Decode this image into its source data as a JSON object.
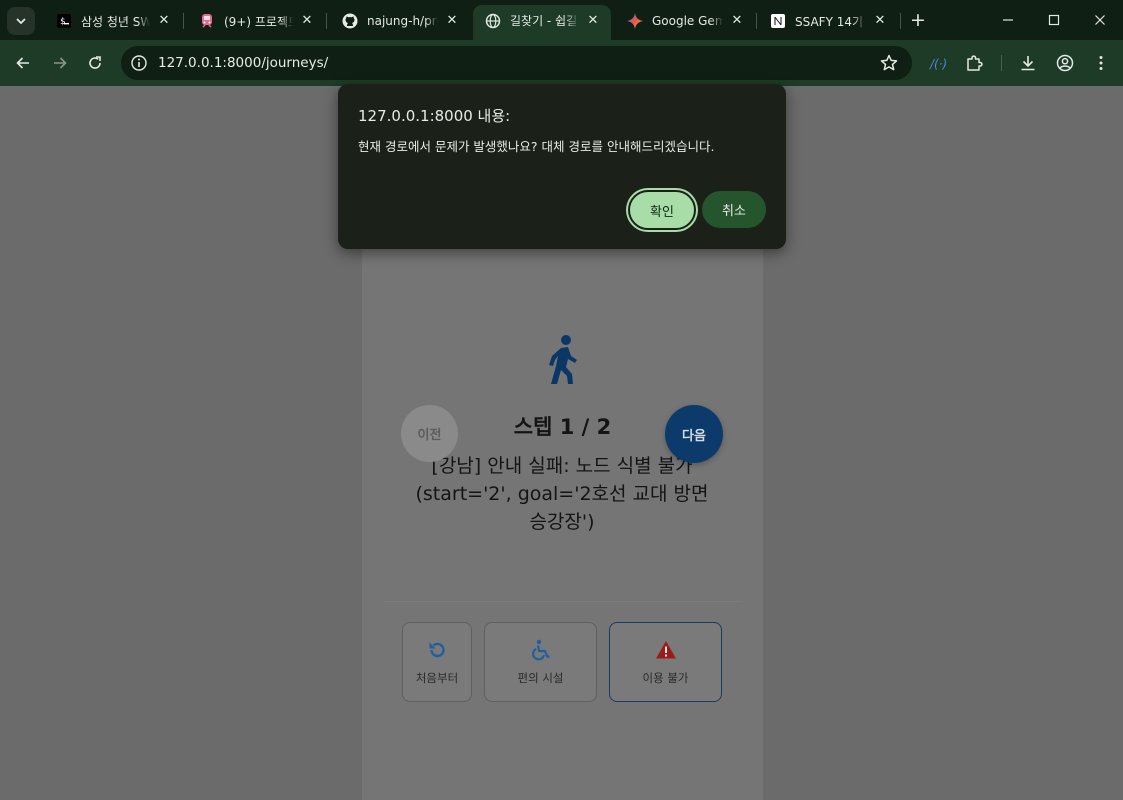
{
  "browser": {
    "tabs": [
      {
        "title": "삼성 청년 SW",
        "icon": "terminal-dollar-icon"
      },
      {
        "title": "(9+) 프로젝트",
        "icon": "train-icon"
      },
      {
        "title": "najung-h/pro",
        "icon": "github-icon"
      },
      {
        "title": "길찾기 - 쉽길",
        "icon": "globe-icon"
      },
      {
        "title": "Google Gemi",
        "icon": "gemini-icon"
      },
      {
        "title": "SSAFY 14기",
        "icon": "notion-icon"
      }
    ],
    "url": "127.0.0.1:8000/journeys/"
  },
  "page": {
    "step_title": "스텝 1 / 2",
    "step_description": "[강남] 안내 실패: 노드 식별 불가 (start='2', goal='2호선 교대 방면 승강장')",
    "prev_label": "이전",
    "next_label": "다음",
    "actions": [
      {
        "label": "처음부터",
        "icon": "restart-icon"
      },
      {
        "label": "편의 시설",
        "icon": "wheelchair-icon"
      },
      {
        "label": "이용 불가",
        "icon": "warning-icon"
      }
    ]
  },
  "dialog": {
    "title": "127.0.0.1:8000 내용:",
    "message": "현재 경로에서 문제가 발생했나요? 대체 경로를 안내해드리겠습니다.",
    "ok_label": "확인",
    "cancel_label": "취소"
  },
  "colors": {
    "chrome_dark": "#0f1f13",
    "chrome_tab_active": "#1d3b26",
    "dialog_bg": "#1b2119",
    "ok_button": "#a9dda8",
    "cancel_button": "#24552c",
    "next_button": "#0c3b6b",
    "icon_blue": "#1f5fa0",
    "warning_red": "#9b1b1b"
  }
}
